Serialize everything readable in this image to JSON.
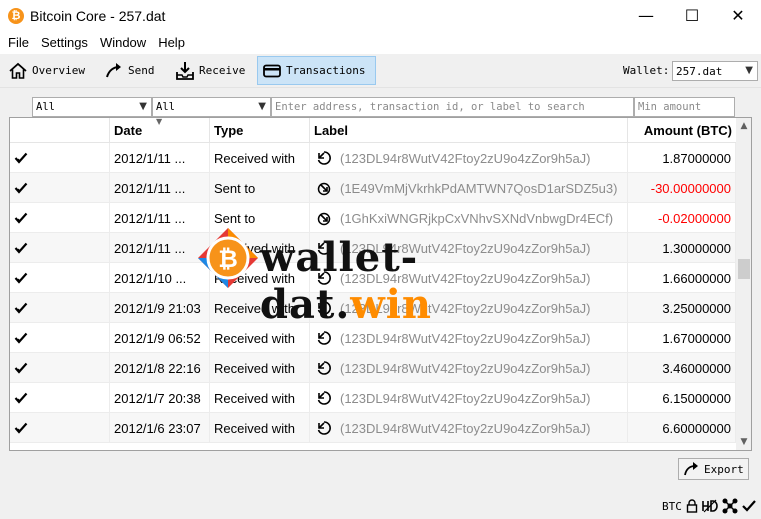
{
  "window": {
    "title": "Bitcoin Core - 257.dat",
    "app_icon_glyph": "₿",
    "controls": [
      "—",
      "☐",
      "✕"
    ]
  },
  "menu": [
    "File",
    "Settings",
    "Window",
    "Help"
  ],
  "toolbar": {
    "overview": "Overview",
    "send": "Send",
    "receive": "Receive",
    "transactions": "Transactions",
    "wallet_label": "Wallet:",
    "wallet_value": "257.dat",
    "active_color": "#cce4f7"
  },
  "filters": {
    "date": "All",
    "type": "All",
    "search_placeholder": "Enter address, transaction id, or label to search",
    "min_amount_placeholder": "Min amount"
  },
  "table": {
    "headers": {
      "date": "Date",
      "type": "Type",
      "label": "Label",
      "amount": "Amount (BTC)"
    },
    "rows": [
      {
        "status": "✔",
        "date": "2012/1/11 ...",
        "type": "Received with",
        "dir": "in",
        "label": "(123DL94r8WutV42Ftoy2zU9o4zZor9h5aJ)",
        "amount": "1.87000000",
        "negative": false
      },
      {
        "status": "✔",
        "date": "2012/1/11 ...",
        "type": "Sent to",
        "dir": "out",
        "label": "(1E49VmMjVkrhkPdAMTWN7QosD1arSDZ5u3)",
        "amount": "-30.00000000",
        "negative": true
      },
      {
        "status": "✔",
        "date": "2012/1/11 ...",
        "type": "Sent to",
        "dir": "out",
        "label": "(1GhKxiWNGRjkpCxVNhvSXNdVnbwgDr4ECf)",
        "amount": "-0.02000000",
        "negative": true
      },
      {
        "status": "✔",
        "date": "2012/1/11 ...",
        "type": "Received with",
        "dir": "in",
        "label": "(123DL94r8WutV42Ftoy2zU9o4zZor9h5aJ)",
        "amount": "1.30000000",
        "negative": false
      },
      {
        "status": "✔",
        "date": "2012/1/10 ...",
        "type": "Received with",
        "dir": "in",
        "label": "(123DL94r8WutV42Ftoy2zU9o4zZor9h5aJ)",
        "amount": "1.66000000",
        "negative": false
      },
      {
        "status": "✔",
        "date": "2012/1/9 21:03",
        "type": "Received with",
        "dir": "in",
        "label": "(123DL94r8WutV42Ftoy2zU9o4zZor9h5aJ)",
        "amount": "3.25000000",
        "negative": false
      },
      {
        "status": "✔",
        "date": "2012/1/9 06:52",
        "type": "Received with",
        "dir": "in",
        "label": "(123DL94r8WutV42Ftoy2zU9o4zZor9h5aJ)",
        "amount": "1.67000000",
        "negative": false
      },
      {
        "status": "✔",
        "date": "2012/1/8 22:16",
        "type": "Received with",
        "dir": "in",
        "label": "(123DL94r8WutV42Ftoy2zU9o4zZor9h5aJ)",
        "amount": "3.46000000",
        "negative": false
      },
      {
        "status": "✔",
        "date": "2012/1/7 20:38",
        "type": "Received with",
        "dir": "in",
        "label": "(123DL94r8WutV42Ftoy2zU9o4zZor9h5aJ)",
        "amount": "6.15000000",
        "negative": false
      },
      {
        "status": "✔",
        "date": "2012/1/6 23:07",
        "type": "Received with",
        "dir": "in",
        "label": "(123DL94r8WutV42Ftoy2zU9o4zZor9h5aJ)",
        "amount": "6.60000000",
        "negative": false
      }
    ],
    "negative_color": "#ff0000",
    "label_color": "#8c8c8c"
  },
  "watermark": {
    "prefix": "wallet-dat.",
    "suffix": "win",
    "logo_glyph": "₿",
    "logo_color": "#f7931a",
    "suffix_color": "#ff8c00"
  },
  "export_label": "Export",
  "status": {
    "unit": "BTC",
    "icons": [
      "lock-icon",
      "hd-icon",
      "network-icon",
      "synced-check-icon"
    ]
  }
}
